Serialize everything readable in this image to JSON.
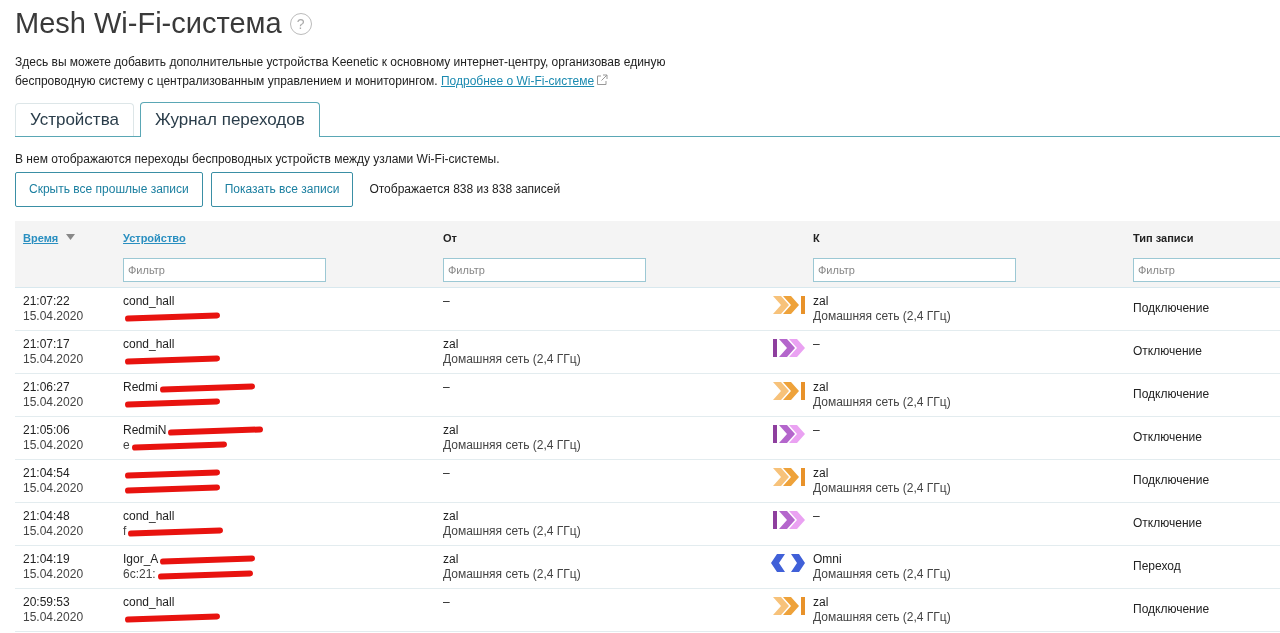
{
  "title": "Mesh Wi-Fi-система",
  "help_glyph": "?",
  "intro": "Здесь вы можете добавить дополнительные устройства Keenetic к основному интернет-центру, организовав единую беспроводную систему с централизованным управлением и мониторингом.",
  "intro_link": "Подробнее о Wi-Fi-системе",
  "tabs": [
    {
      "label": "Устройства",
      "selected": false
    },
    {
      "label": "Журнал переходов",
      "selected": true
    }
  ],
  "description": "В нем отображаются переходы беспроводных устройств между узлами Wi-Fi-системы.",
  "buttons": [
    "Скрыть все прошлые записи",
    "Показать все записи"
  ],
  "record_count": "Отображается 838 из 838 записей",
  "table": {
    "columns": [
      {
        "label": "Время",
        "sortable": true,
        "sorted": true
      },
      {
        "label": "Устройство",
        "sortable": true,
        "sorted": false,
        "filter_placeholder": "Фильтр"
      },
      {
        "label": "От",
        "sortable": false,
        "sorted": false,
        "filter_placeholder": "Фильтр"
      },
      {
        "label": "К",
        "sortable": false,
        "sorted": false,
        "filter_placeholder": "Фильтр"
      },
      {
        "label": "Тип записи",
        "sortable": false,
        "sorted": false,
        "filter_placeholder": "Фильтр"
      }
    ],
    "rows": [
      {
        "time": "21:07:22",
        "date": "15.04.2020",
        "device": [
          {
            "text": "cond_hall",
            "redacted": false
          },
          {
            "redacted": true
          }
        ],
        "from": [
          "–"
        ],
        "kind": "connect",
        "to": [
          "zal",
          "Домашняя сеть (2,4 ГГц)"
        ],
        "type": "Подключение"
      },
      {
        "time": "21:07:17",
        "date": "15.04.2020",
        "device": [
          {
            "text": "cond_hall",
            "redacted": false
          },
          {
            "redacted": true
          }
        ],
        "from": [
          "zal",
          "Домашняя сеть (2,4 ГГц)"
        ],
        "kind": "disconnect",
        "to": [
          "–"
        ],
        "type": "Отключение"
      },
      {
        "time": "21:06:27",
        "date": "15.04.2020",
        "device": [
          {
            "text": "Redmi",
            "redacted": true
          },
          {
            "redacted": true
          }
        ],
        "from": [
          "–"
        ],
        "kind": "connect",
        "to": [
          "zal",
          "Домашняя сеть (2,4 ГГц)"
        ],
        "type": "Подключение"
      },
      {
        "time": "21:05:06",
        "date": "15.04.2020",
        "device": [
          {
            "text": "RedmiN",
            "redacted": true
          },
          {
            "text": "e",
            "redacted": true
          }
        ],
        "from": [
          "zal",
          "Домашняя сеть (2,4 ГГц)"
        ],
        "kind": "disconnect",
        "to": [
          "–"
        ],
        "type": "Отключение"
      },
      {
        "time": "21:04:54",
        "date": "15.04.2020",
        "device": [
          {
            "redacted": true
          },
          {
            "redacted": true
          }
        ],
        "from": [
          "–"
        ],
        "kind": "connect",
        "to": [
          "zal",
          "Домашняя сеть (2,4 ГГц)"
        ],
        "type": "Подключение"
      },
      {
        "time": "21:04:48",
        "date": "15.04.2020",
        "device": [
          {
            "text": "cond_hall",
            "redacted": false
          },
          {
            "text": "f",
            "redacted": true
          }
        ],
        "from": [
          "zal",
          "Домашняя сеть (2,4 ГГц)"
        ],
        "kind": "disconnect",
        "to": [
          "–"
        ],
        "type": "Отключение"
      },
      {
        "time": "21:04:19",
        "date": "15.04.2020",
        "device": [
          {
            "text": "Igor_A",
            "redacted": true
          },
          {
            "text": "6c:21:",
            "redacted": true
          }
        ],
        "from": [
          "zal",
          "Домашняя сеть (2,4 ГГц)"
        ],
        "kind": "roam",
        "to": [
          "Omni",
          "Домашняя сеть (2,4 ГГц)"
        ],
        "type": "Переход"
      },
      {
        "time": "20:59:53",
        "date": "15.04.2020",
        "device": [
          {
            "text": "cond_hall",
            "redacted": false
          },
          {
            "redacted": true
          }
        ],
        "from": [
          "–"
        ],
        "kind": "connect",
        "to": [
          "zal",
          "Домашняя сеть (2,4 ГГц)"
        ],
        "type": "Подключение"
      }
    ]
  }
}
